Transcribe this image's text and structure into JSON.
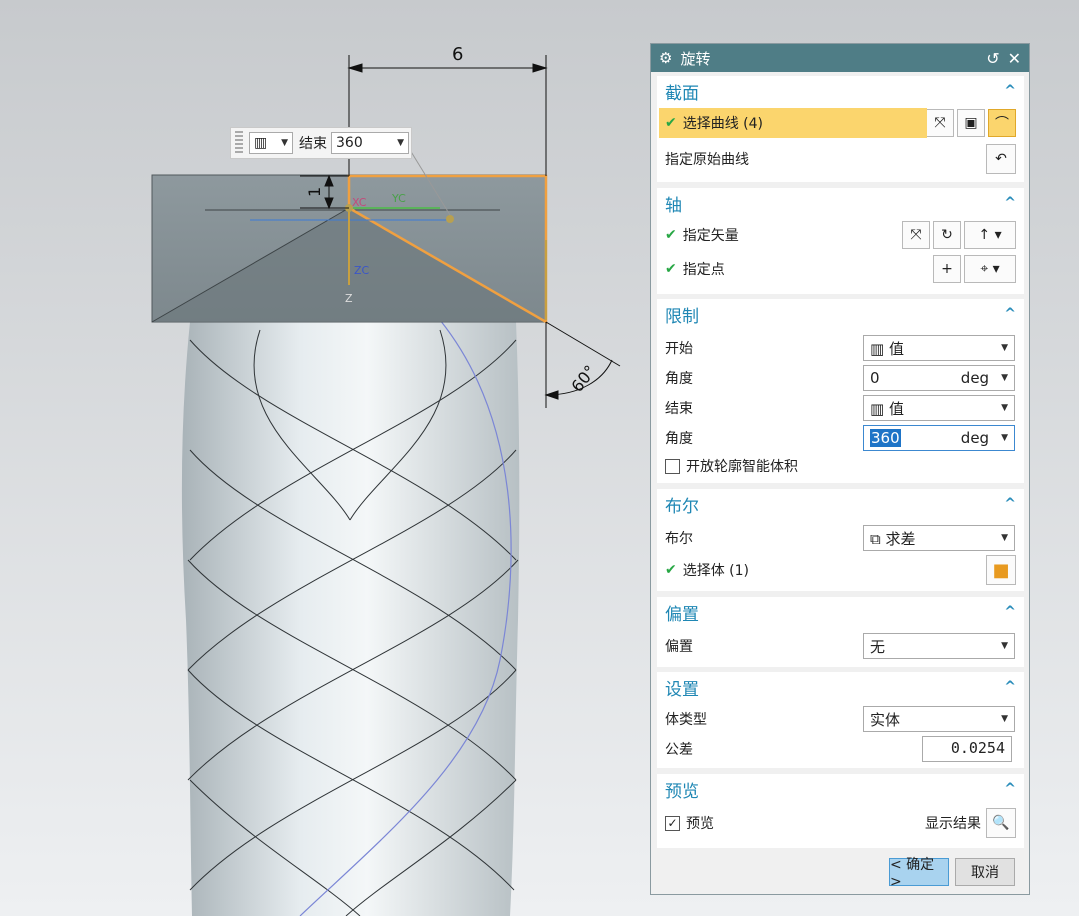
{
  "viewport": {
    "dim_top": "6",
    "dim_left": "1",
    "dim_angle": "60°",
    "csys_labels": [
      "XC",
      "YC",
      "ZC",
      "Z"
    ],
    "mini_toolbar": {
      "end_label": "结束",
      "end_value": "360"
    }
  },
  "dialog": {
    "title": "旋转",
    "sections": {
      "section": {
        "title": "截面",
        "select_curve": "选择曲线 (4)",
        "specify_original": "指定原始曲线"
      },
      "axis": {
        "title": "轴",
        "specify_vector": "指定矢量",
        "specify_point": "指定点"
      },
      "limits": {
        "title": "限制",
        "start_label": "开始",
        "start_value": "值",
        "start_angle_label": "角度",
        "start_angle": "0",
        "start_unit": "deg",
        "end_label": "结束",
        "end_value": "值",
        "end_angle_label": "角度",
        "end_angle": "360",
        "end_unit": "deg",
        "open_profile": "开放轮廓智能体积"
      },
      "boolean": {
        "title": "布尔",
        "bool_label": "布尔",
        "bool_value": "求差",
        "select_body": "选择体 (1)"
      },
      "offset": {
        "title": "偏置",
        "offset_label": "偏置",
        "offset_value": "无"
      },
      "settings": {
        "title": "设置",
        "body_type_label": "体类型",
        "body_type_value": "实体",
        "tolerance_label": "公差",
        "tolerance_value": "0.0254"
      },
      "preview": {
        "title": "预览",
        "preview_label": "预览",
        "show_result": "显示结果"
      }
    },
    "buttons": {
      "ok": "< 确定 >",
      "cancel": "取消"
    }
  },
  "colors": {
    "title_bar": "#4f7d86",
    "section_header": "#1f87b4",
    "highlight": "#fbd56d",
    "sketch_orange": "#f0a040",
    "model_gray": "#b9c1c5"
  }
}
